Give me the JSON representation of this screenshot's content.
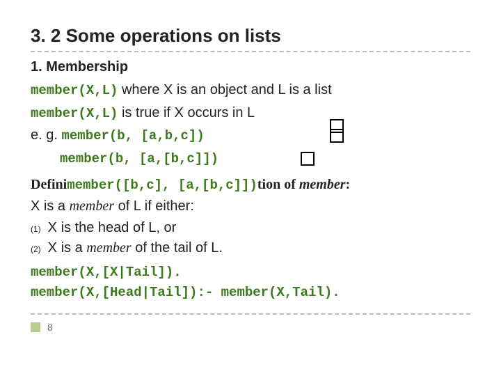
{
  "title": "3. 2 Some operations on lists",
  "section1": {
    "heading": "1. Membership",
    "l1a": "member(X,L)",
    "l1b": " where X is an object and L is a list",
    "l2a": "member(X,L)",
    "l2b": " is true if X occurs in L",
    "eg_prefix": "e. g. ",
    "eg1": "member(b, [a,b,c])",
    "eg2": "member(b, [a,[b,c]])"
  },
  "section2": {
    "defini": "Defini",
    "defini_code": "member([b,c], [a,[b,c]])",
    "defini_tail": "tion of ",
    "defini_bolditalic": "member",
    "defini_colon": ":",
    "l1_a": "X is a ",
    "l1_b": "member",
    "l1_c": " of L if either:",
    "ord1": "(1)",
    "ord1_text": "X is the head of L, or",
    "ord2": "(2)",
    "ord2_a": "X is a ",
    "ord2_b": "member",
    "ord2_c": " of the tail of L."
  },
  "codeblock": {
    "l1": "member(X,[X|Tail]).",
    "l2": "member(X,[Head|Tail]):- member(X,Tail)."
  },
  "pagenum": "8"
}
